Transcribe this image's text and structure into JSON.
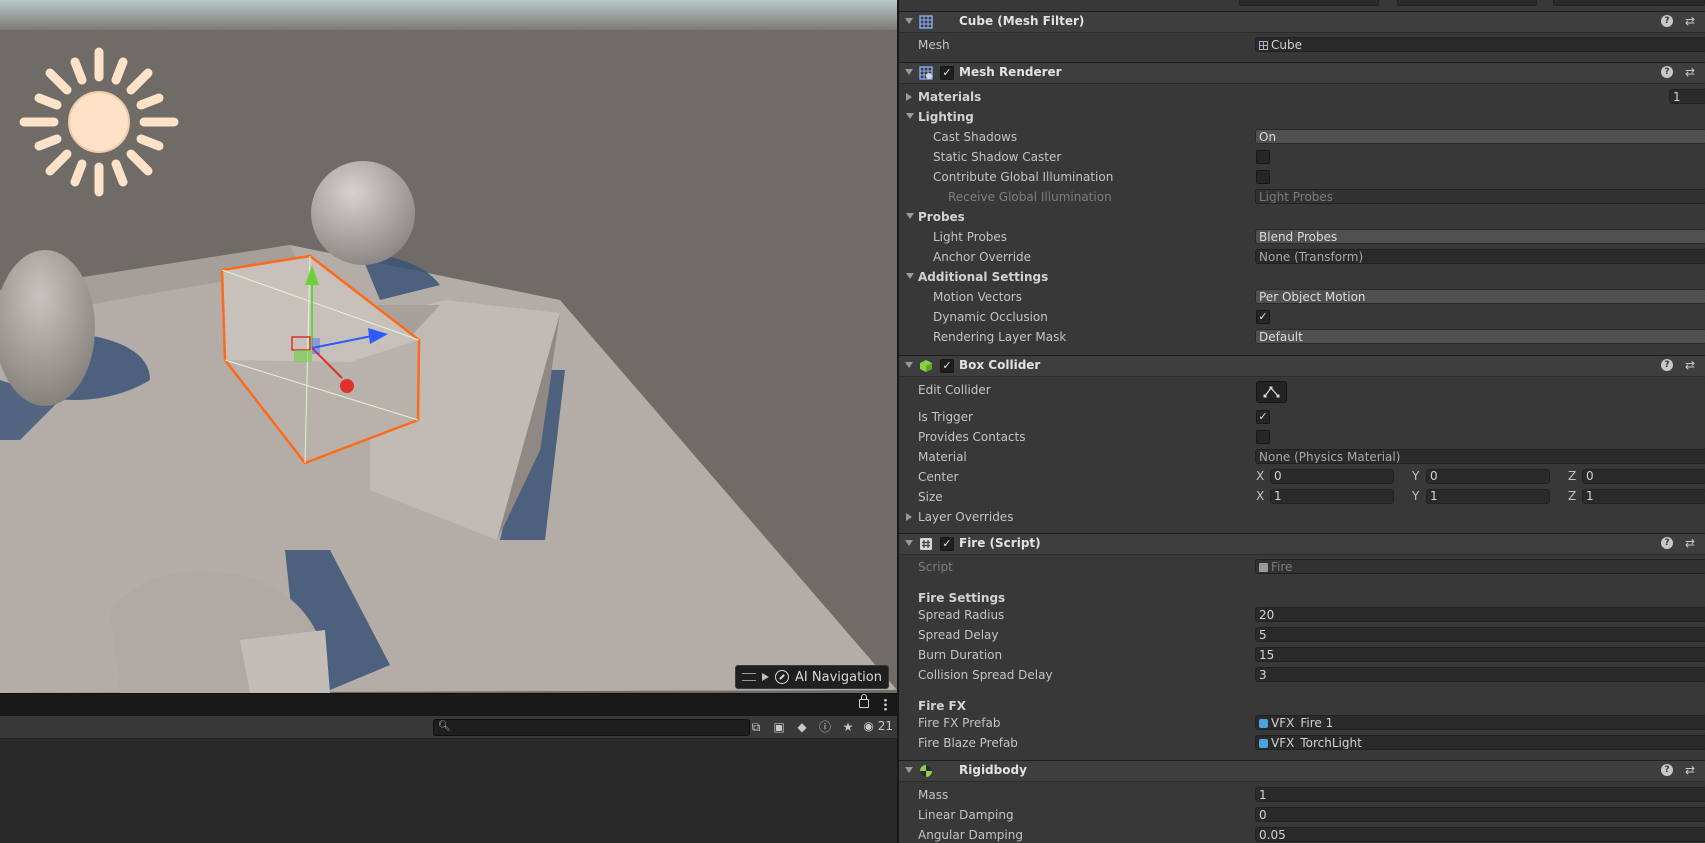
{
  "scene": {
    "ai_navigation_label": "AI Navigation"
  },
  "hierarchy": {
    "search_placeholder": "",
    "visible_count": "21"
  },
  "inspector": {
    "mesh_filter": {
      "title": "Cube (Mesh Filter)",
      "mesh_label": "Mesh",
      "mesh_value": "Cube"
    },
    "mesh_renderer": {
      "title": "Mesh Renderer",
      "enabled": true,
      "materials_label": "Materials",
      "materials_count": "1",
      "lighting_label": "Lighting",
      "cast_shadows_label": "Cast Shadows",
      "cast_shadows_value": "On",
      "static_shadow_caster_label": "Static Shadow Caster",
      "static_shadow_caster": false,
      "contribute_gi_label": "Contribute Global Illumination",
      "contribute_gi": false,
      "receive_gi_label": "Receive Global Illumination",
      "receive_gi_value": "Light Probes",
      "probes_label": "Probes",
      "light_probes_label": "Light Probes",
      "light_probes_value": "Blend Probes",
      "anchor_override_label": "Anchor Override",
      "anchor_override_value": "None (Transform)",
      "additional_settings_label": "Additional Settings",
      "motion_vectors_label": "Motion Vectors",
      "motion_vectors_value": "Per Object Motion",
      "dynamic_occlusion_label": "Dynamic Occlusion",
      "dynamic_occlusion": true,
      "rendering_layer_mask_label": "Rendering Layer Mask",
      "rendering_layer_mask_value": "Default"
    },
    "box_collider": {
      "title": "Box Collider",
      "enabled": true,
      "edit_collider_label": "Edit Collider",
      "is_trigger_label": "Is Trigger",
      "is_trigger": true,
      "provides_contacts_label": "Provides Contacts",
      "provides_contacts": false,
      "material_label": "Material",
      "material_value": "None (Physics Material)",
      "center_label": "Center",
      "center": {
        "x": "0",
        "y": "0",
        "z": "0"
      },
      "size_label": "Size",
      "size": {
        "x": "1",
        "y": "1",
        "z": "1"
      },
      "layer_overrides_label": "Layer Overrides"
    },
    "fire_script": {
      "title": "Fire (Script)",
      "enabled": true,
      "script_label": "Script",
      "script_value": "Fire",
      "fire_settings_header": "Fire Settings",
      "spread_radius_label": "Spread Radius",
      "spread_radius": "20",
      "spread_delay_label": "Spread Delay",
      "spread_delay": "5",
      "burn_duration_label": "Burn Duration",
      "burn_duration": "15",
      "collision_spread_delay_label": "Collision Spread Delay",
      "collision_spread_delay": "3",
      "fire_fx_header": "Fire FX",
      "fire_fx_prefab_label": "Fire FX Prefab",
      "fire_fx_prefab": "VFX_Fire 1",
      "fire_blaze_prefab_label": "Fire Blaze Prefab",
      "fire_blaze_prefab": "VFX_TorchLight"
    },
    "rigidbody": {
      "title": "Rigidbody",
      "mass_label": "Mass",
      "mass": "1",
      "linear_damping_label": "Linear Damping",
      "linear_damping": "0",
      "angular_damping_label": "Angular Damping",
      "angular_damping": "0.05"
    },
    "axis_labels": {
      "x": "X",
      "y": "Y",
      "z": "Z"
    }
  },
  "colors": {
    "selection_outline": "#ff6a1a",
    "gizmo_x": "#e0302a",
    "gizmo_y": "#6bd23c",
    "gizmo_z": "#2f5cff",
    "sun_icon": "#ffe2c8"
  }
}
